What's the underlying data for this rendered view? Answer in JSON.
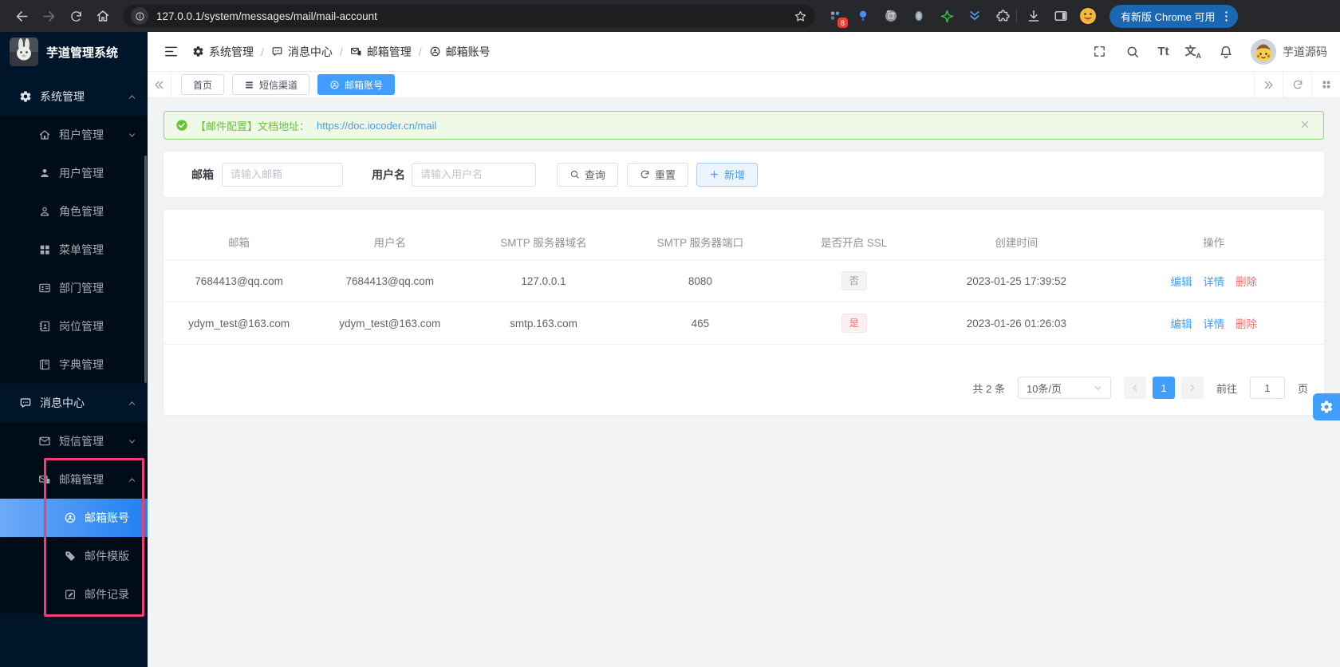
{
  "colors": {
    "primary": "#409eff",
    "success": "#67c23a",
    "danger": "#f56c6c",
    "sidebar_bg": "#001529",
    "sidebar_sub_bg": "#000c17",
    "annotation_pink": "#ee3f73",
    "chrome_update_pill": "#1b67b2"
  },
  "browser": {
    "url": "127.0.0.1/system/messages/mail/mail-account",
    "extension_badge_count": "8",
    "update_button_label": "有新版 Chrome 可用"
  },
  "sidebar": {
    "app_title": "芋道管理系统",
    "items": [
      {
        "label": "系统管理"
      },
      {
        "label": "租户管理"
      },
      {
        "label": "用户管理"
      },
      {
        "label": "角色管理"
      },
      {
        "label": "菜单管理"
      },
      {
        "label": "部门管理"
      },
      {
        "label": "岗位管理"
      },
      {
        "label": "字典管理"
      },
      {
        "label": "消息中心"
      },
      {
        "label": "短信管理"
      },
      {
        "label": "邮箱管理"
      },
      {
        "label": "邮箱账号"
      },
      {
        "label": "邮件模版"
      },
      {
        "label": "邮件记录"
      }
    ]
  },
  "header": {
    "breadcrumb": [
      {
        "label": "系统管理"
      },
      {
        "label": "消息中心"
      },
      {
        "label": "邮箱管理"
      },
      {
        "label": "邮箱账号"
      }
    ],
    "separator": "/",
    "font_icon_text": "Tt",
    "lang_icon_zh": "文",
    "lang_icon_en": "A",
    "username": "芋道源码"
  },
  "tabbar": {
    "tabs": [
      {
        "label": "首页"
      },
      {
        "label": "短信渠道"
      },
      {
        "label": "邮箱账号"
      }
    ]
  },
  "alert": {
    "text": "【邮件配置】文档地址：",
    "link": "https://doc.iocoder.cn/mail"
  },
  "filters": {
    "email_label": "邮箱",
    "email_placeholder": "请输入邮箱",
    "username_label": "用户名",
    "username_placeholder": "请输入用户名",
    "search_button": "查询",
    "reset_button": "重置",
    "add_button": "新增"
  },
  "table": {
    "columns": [
      {
        "label": "邮箱"
      },
      {
        "label": "用户名"
      },
      {
        "label": "SMTP 服务器域名"
      },
      {
        "label": "SMTP 服务器端口"
      },
      {
        "label": "是否开启 SSL"
      },
      {
        "label": "创建时间"
      },
      {
        "label": "操作"
      }
    ],
    "rows": [
      {
        "mail": "7684413@qq.com",
        "username": "7684413@qq.com",
        "smtp_domain": "127.0.0.1",
        "smtp_port": "8080",
        "ssl": "否",
        "created_at": "2023-01-25 17:39:52"
      },
      {
        "mail": "ydym_test@163.com",
        "username": "ydym_test@163.com",
        "smtp_domain": "smtp.163.com",
        "smtp_port": "465",
        "ssl": "是",
        "created_at": "2023-01-26 01:26:03"
      }
    ],
    "actions": {
      "edit": "编辑",
      "detail": "详情",
      "delete": "删除"
    }
  },
  "pagination": {
    "total_text": "共 2 条",
    "page_size_text": "10条/页",
    "current_page": "1",
    "goto_text": "前往",
    "goto_value": "1",
    "unit_text": "页"
  }
}
